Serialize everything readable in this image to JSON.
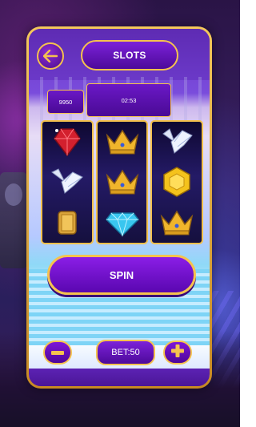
{
  "header": {
    "title": "SLOTS",
    "back_icon": "back-arrow-icon"
  },
  "stats": {
    "credits": "9950",
    "timer": "02:53"
  },
  "reels": [
    [
      "ruby-gem-icon",
      "crown-icon",
      "diamond-bird-icon"
    ],
    [
      "crown-icon",
      "crown-icon",
      "diamond-bird-icon"
    ],
    [
      "topaz-gem-icon",
      "blue-diamond-icon",
      "crown-icon"
    ]
  ],
  "controls": {
    "spin_label": "SPIN",
    "bet_label": "BET:50",
    "minus_label": "−",
    "plus_label": "+"
  },
  "colors": {
    "accent_gold": "#f5c24e",
    "button_purple": "#6a10c8"
  }
}
